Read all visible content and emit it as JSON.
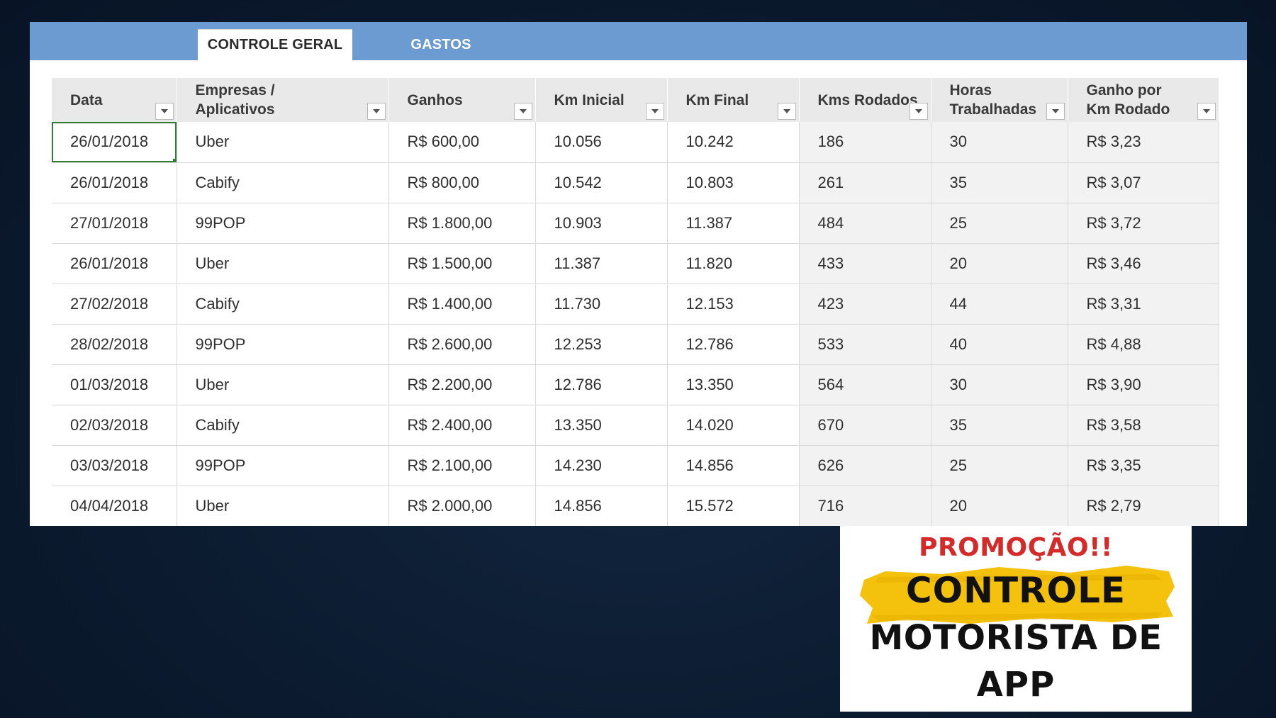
{
  "tabs": [
    {
      "label": "CONTROLE GERAL",
      "active": true
    },
    {
      "label": "GASTOS",
      "active": false
    }
  ],
  "colors": {
    "tabbar": "#6b9bd1",
    "header_bg": "#e9e9e9",
    "selection": "#2e7d32",
    "promo_title": "#d42a2a",
    "promo_brush": "#f4c20d",
    "background": "#0d1d33"
  },
  "table": {
    "columns": [
      "Data",
      "Empresas / Aplicativos",
      "Ganhos",
      "Km Inicial",
      "Km Final",
      "Kms Rodados",
      "Horas Trabalhadas",
      "Ganho por Km Rodado"
    ],
    "filter_icon": "chevron-down-icon",
    "rows": [
      [
        "26/01/2018",
        "Uber",
        "R$ 600,00",
        "10.056",
        "10.242",
        "186",
        "30",
        "R$ 3,23"
      ],
      [
        "26/01/2018",
        "Cabify",
        "R$ 800,00",
        "10.542",
        "10.803",
        "261",
        "35",
        "R$ 3,07"
      ],
      [
        "27/01/2018",
        "99POP",
        "R$ 1.800,00",
        "10.903",
        "11.387",
        "484",
        "25",
        "R$ 3,72"
      ],
      [
        "26/01/2018",
        "Uber",
        "R$ 1.500,00",
        "11.387",
        "11.820",
        "433",
        "20",
        "R$ 3,46"
      ],
      [
        "27/02/2018",
        "Cabify",
        "R$ 1.400,00",
        "11.730",
        "12.153",
        "423",
        "44",
        "R$ 3,31"
      ],
      [
        "28/02/2018",
        "99POP",
        "R$ 2.600,00",
        "12.253",
        "12.786",
        "533",
        "40",
        "R$ 4,88"
      ],
      [
        "01/03/2018",
        "Uber",
        "R$ 2.200,00",
        "12.786",
        "13.350",
        "564",
        "30",
        "R$ 3,90"
      ],
      [
        "02/03/2018",
        "Cabify",
        "R$ 2.400,00",
        "13.350",
        "14.020",
        "670",
        "35",
        "R$ 3,58"
      ],
      [
        "03/03/2018",
        "99POP",
        "R$ 2.100,00",
        "14.230",
        "14.856",
        "626",
        "25",
        "R$ 3,35"
      ],
      [
        "04/04/2018",
        "Uber",
        "R$ 2.000,00",
        "14.856",
        "15.572",
        "716",
        "20",
        "R$ 2,79"
      ]
    ]
  },
  "promo": {
    "title": "PROMOÇÃO!!",
    "line1": "CONTROLE",
    "line2": "MOTORISTA DE",
    "line3": "APP"
  }
}
